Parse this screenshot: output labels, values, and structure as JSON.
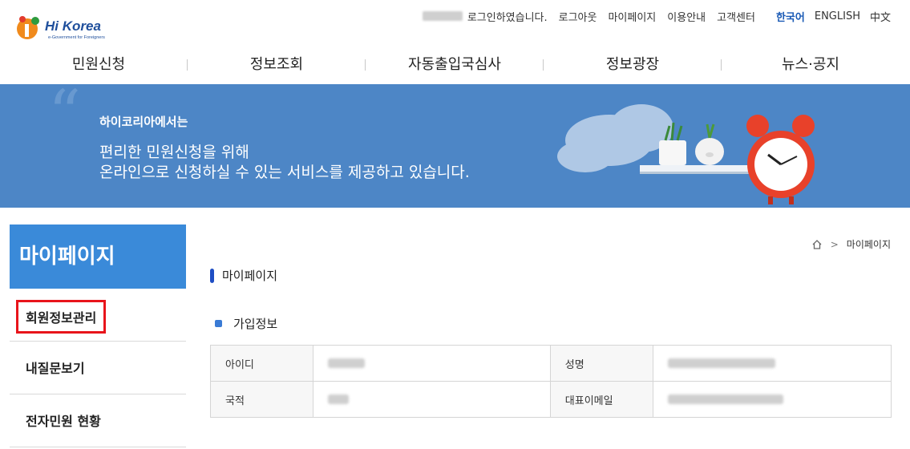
{
  "header": {
    "logo_text": "Hi Korea",
    "logo_subtext": "e-Government for Foreigners",
    "util": {
      "login_msg": "로그인하였습니다.",
      "links": [
        "로그아웃",
        "마이페이지",
        "이용안내",
        "고객센터"
      ],
      "languages": [
        {
          "label": "한국어",
          "active": true
        },
        {
          "label": "ENGLISH",
          "active": false
        },
        {
          "label": "中文",
          "active": false
        }
      ]
    },
    "nav": [
      "민원신청",
      "정보조회",
      "자동출입국심사",
      "정보광장",
      "뉴스·공지"
    ]
  },
  "banner": {
    "line1": "하이코리아에서는",
    "line2": "편리한 민원신청을 위해",
    "line3": "온라인으로 신청하실 수 있는 서비스를 제공하고 있습니다."
  },
  "sidebar": {
    "title": "마이페이지",
    "items": [
      {
        "label": "회원정보관리",
        "highlighted": true
      },
      {
        "label": "내질문보기",
        "highlighted": false
      },
      {
        "label": "전자민원 현황",
        "highlighted": false
      }
    ]
  },
  "breadcrumb": {
    "sep": ">",
    "current": "마이페이지"
  },
  "main": {
    "section_title": "마이페이지",
    "sub_title": "가입정보",
    "table": {
      "row1": {
        "label1": "아이디",
        "label2": "성명"
      },
      "row2": {
        "label1": "국적",
        "label2": "대표이메일"
      }
    }
  },
  "colors": {
    "sidebar_title_bg": "#3a8ad9",
    "banner_bg": "#4d86c6",
    "highlight_border": "#e8141b",
    "active_lang": "#1a5ab5"
  }
}
